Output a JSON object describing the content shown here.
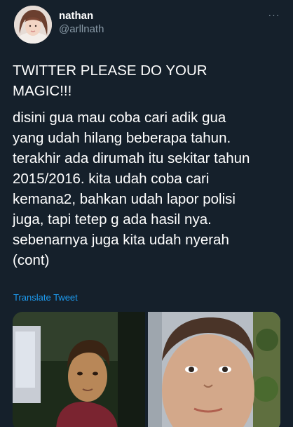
{
  "user": {
    "display_name": "nathan",
    "handle": "@arllnath"
  },
  "tweet": {
    "paragraphs": [
      "TWITTER PLEASE DO YOUR\nMAGIC!!!",
      "disini gua mau coba cari adik gua\nyang udah hilang beberapa tahun.\nterakhir ada dirumah itu sekitar tahun\n2015/2016. kita udah coba cari\nkemana2, bahkan udah lapor polisi\njuga, tapi tetep g ada hasil nya.\nsebenarnya juga kita udah nyerah\n(cont)"
    ],
    "translate_label": "Translate Tweet",
    "more_icon": "···"
  },
  "icons": {
    "more": "more-dots-icon"
  },
  "colors": {
    "background": "#15202b",
    "text": "#ffffff",
    "secondary": "#8899a6",
    "link": "#1d9bf0"
  }
}
